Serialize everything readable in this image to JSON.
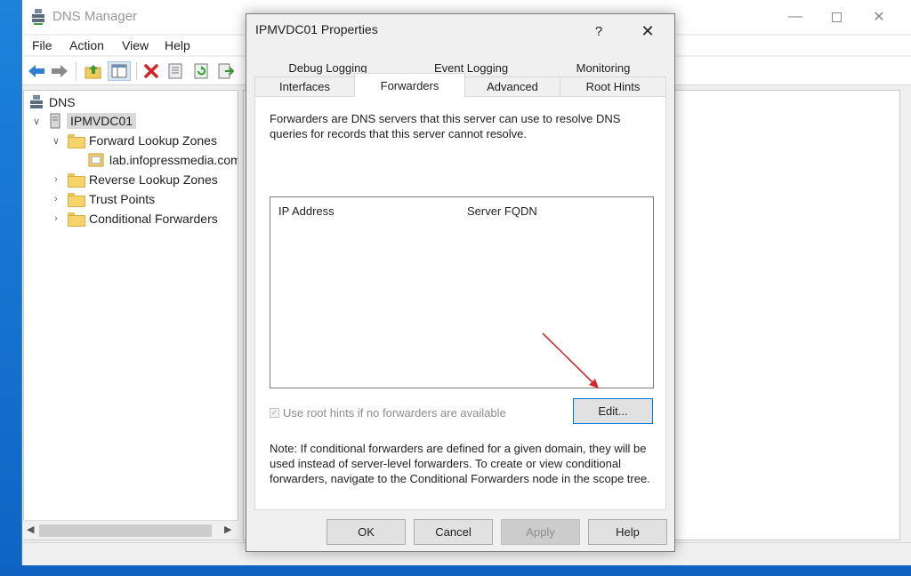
{
  "window": {
    "title": "DNS Manager",
    "menu": [
      "File",
      "Action",
      "View",
      "Help"
    ],
    "toolbar_icons": [
      "back-arrow-icon",
      "forward-arrow-icon",
      "up-folder-icon",
      "show-hide-tree-icon",
      "delete-icon",
      "properties-icon",
      "refresh-icon",
      "export-list-icon"
    ]
  },
  "tree": {
    "root": "DNS",
    "server": "IPMVDC01",
    "items": [
      {
        "label": "Forward Lookup Zones",
        "expanded": true
      },
      {
        "label": "lab.infopressmedia.com",
        "child": true
      },
      {
        "label": "Reverse Lookup Zones",
        "expanded": false
      },
      {
        "label": "Trust Points",
        "expanded": false
      },
      {
        "label": "Conditional Forwarders",
        "expanded": false
      }
    ]
  },
  "dialog": {
    "title": "IPMVDC01 Properties",
    "help_glyph": "?",
    "close_glyph": "✕",
    "tabs_row1": [
      "Debug Logging",
      "Event Logging",
      "Monitoring"
    ],
    "tabs_row2": [
      "Interfaces",
      "Forwarders",
      "Advanced",
      "Root Hints"
    ],
    "active_tab": "Forwarders",
    "description": "Forwarders are DNS servers that this server can use to resolve DNS queries for records that this server cannot resolve.",
    "columns": [
      "IP Address",
      "Server FQDN"
    ],
    "root_hints_checkbox": {
      "label": "Use root hints if no forwarders are available",
      "checked": true,
      "disabled": true
    },
    "edit_button": "Edit...",
    "note": "Note: If conditional forwarders are defined for a given domain, they will be used instead of server-level forwarders.  To create or view conditional forwarders, navigate to the Conditional Forwarders node in the scope tree.",
    "buttons": [
      "OK",
      "Cancel",
      "Apply",
      "Help"
    ],
    "apply_disabled": true
  },
  "colors": {
    "desktop": "#1a7bd6",
    "annotation_arrow": "#d42a2a",
    "focus_border": "#0078d7"
  }
}
